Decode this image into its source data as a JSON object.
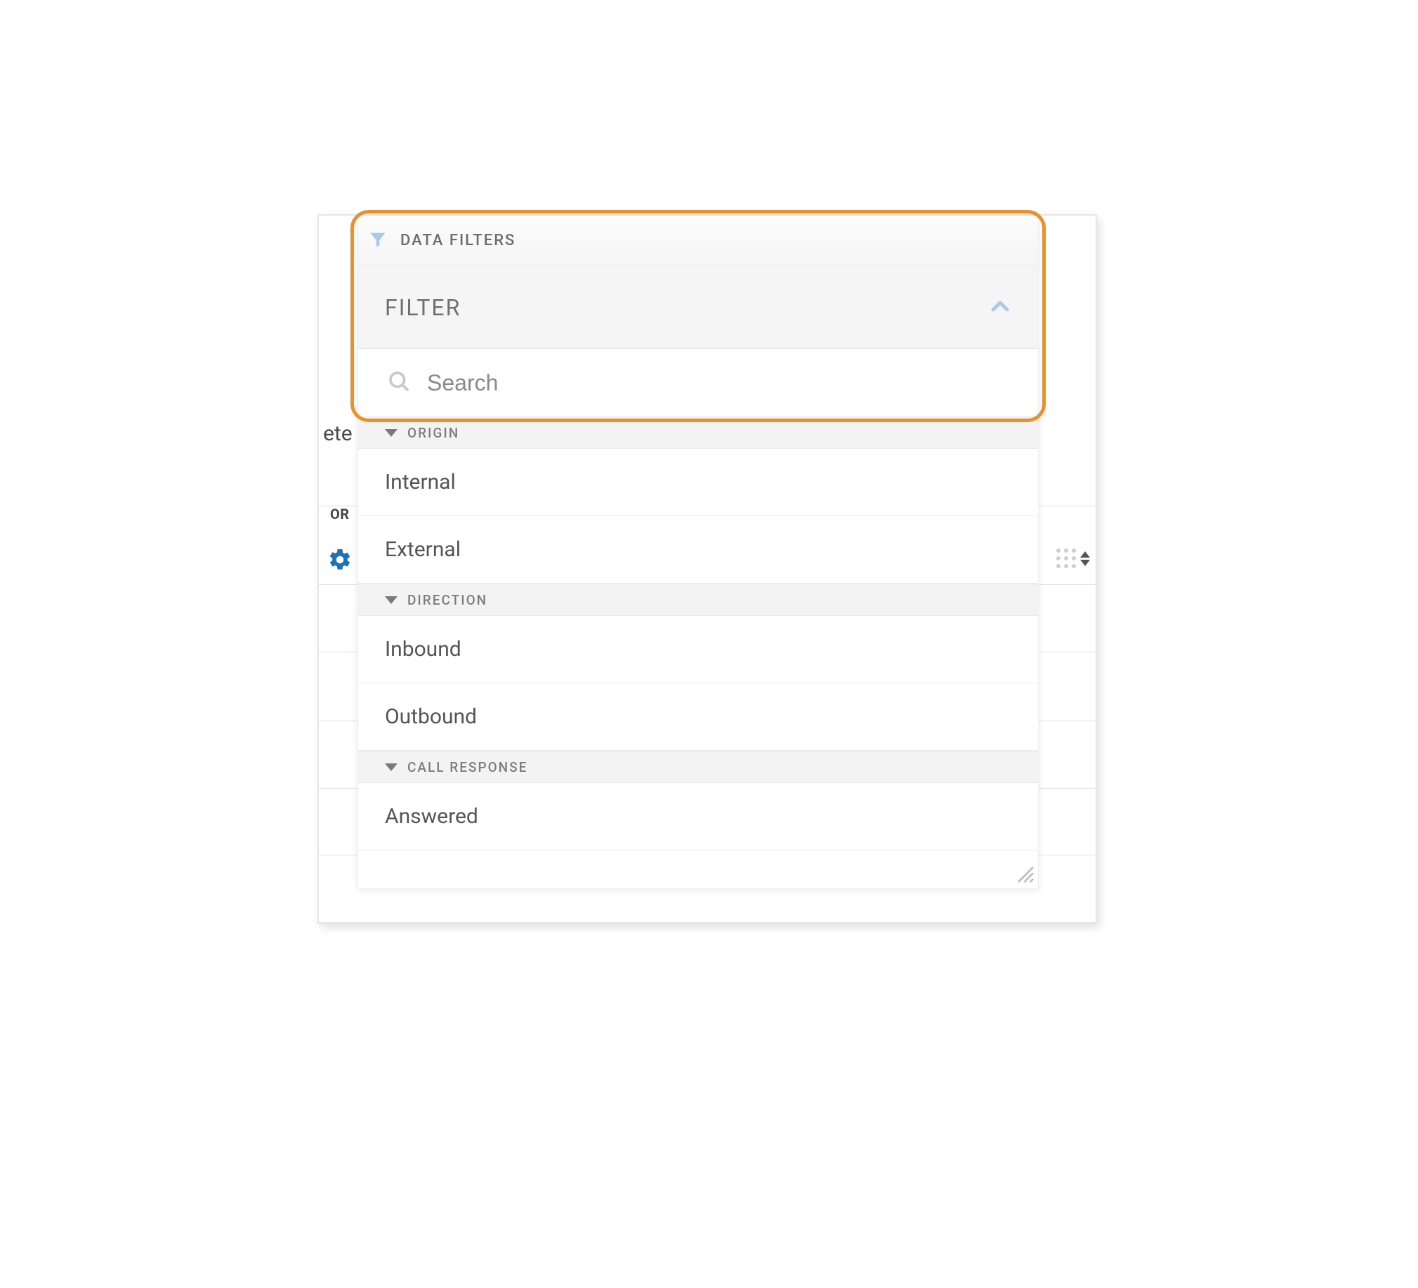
{
  "header": {
    "title": "DATA FILTERS"
  },
  "filter": {
    "label": "FILTER"
  },
  "search": {
    "placeholder": "Search"
  },
  "groups": [
    {
      "label": "ORIGIN",
      "options": [
        "Internal",
        "External"
      ]
    },
    {
      "label": "DIRECTION",
      "options": [
        "Inbound",
        "Outbound"
      ]
    },
    {
      "label": "CALL RESPONSE",
      "options": [
        "Answered"
      ]
    }
  ],
  "background": {
    "text_fragment_left_1": "ete",
    "text_fragment_left_2": "OR"
  },
  "colors": {
    "highlight_border": "#e8912e",
    "icon_accent": "#a9cbe8",
    "gear_icon": "#1e73b8"
  }
}
